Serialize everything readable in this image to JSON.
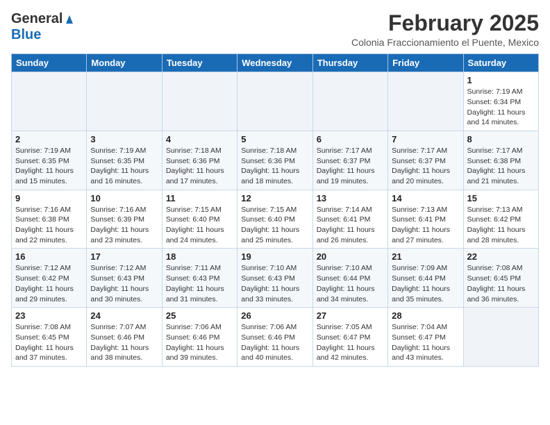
{
  "header": {
    "logo_general": "General",
    "logo_blue": "Blue",
    "month_title": "February 2025",
    "subtitle": "Colonia Fraccionamiento el Puente, Mexico"
  },
  "days_of_week": [
    "Sunday",
    "Monday",
    "Tuesday",
    "Wednesday",
    "Thursday",
    "Friday",
    "Saturday"
  ],
  "weeks": [
    [
      {
        "day": "",
        "info": ""
      },
      {
        "day": "",
        "info": ""
      },
      {
        "day": "",
        "info": ""
      },
      {
        "day": "",
        "info": ""
      },
      {
        "day": "",
        "info": ""
      },
      {
        "day": "",
        "info": ""
      },
      {
        "day": "1",
        "info": "Sunrise: 7:19 AM\nSunset: 6:34 PM\nDaylight: 11 hours and 14 minutes."
      }
    ],
    [
      {
        "day": "2",
        "info": "Sunrise: 7:19 AM\nSunset: 6:35 PM\nDaylight: 11 hours and 15 minutes."
      },
      {
        "day": "3",
        "info": "Sunrise: 7:19 AM\nSunset: 6:35 PM\nDaylight: 11 hours and 16 minutes."
      },
      {
        "day": "4",
        "info": "Sunrise: 7:18 AM\nSunset: 6:36 PM\nDaylight: 11 hours and 17 minutes."
      },
      {
        "day": "5",
        "info": "Sunrise: 7:18 AM\nSunset: 6:36 PM\nDaylight: 11 hours and 18 minutes."
      },
      {
        "day": "6",
        "info": "Sunrise: 7:17 AM\nSunset: 6:37 PM\nDaylight: 11 hours and 19 minutes."
      },
      {
        "day": "7",
        "info": "Sunrise: 7:17 AM\nSunset: 6:37 PM\nDaylight: 11 hours and 20 minutes."
      },
      {
        "day": "8",
        "info": "Sunrise: 7:17 AM\nSunset: 6:38 PM\nDaylight: 11 hours and 21 minutes."
      }
    ],
    [
      {
        "day": "9",
        "info": "Sunrise: 7:16 AM\nSunset: 6:38 PM\nDaylight: 11 hours and 22 minutes."
      },
      {
        "day": "10",
        "info": "Sunrise: 7:16 AM\nSunset: 6:39 PM\nDaylight: 11 hours and 23 minutes."
      },
      {
        "day": "11",
        "info": "Sunrise: 7:15 AM\nSunset: 6:40 PM\nDaylight: 11 hours and 24 minutes."
      },
      {
        "day": "12",
        "info": "Sunrise: 7:15 AM\nSunset: 6:40 PM\nDaylight: 11 hours and 25 minutes."
      },
      {
        "day": "13",
        "info": "Sunrise: 7:14 AM\nSunset: 6:41 PM\nDaylight: 11 hours and 26 minutes."
      },
      {
        "day": "14",
        "info": "Sunrise: 7:13 AM\nSunset: 6:41 PM\nDaylight: 11 hours and 27 minutes."
      },
      {
        "day": "15",
        "info": "Sunrise: 7:13 AM\nSunset: 6:42 PM\nDaylight: 11 hours and 28 minutes."
      }
    ],
    [
      {
        "day": "16",
        "info": "Sunrise: 7:12 AM\nSunset: 6:42 PM\nDaylight: 11 hours and 29 minutes."
      },
      {
        "day": "17",
        "info": "Sunrise: 7:12 AM\nSunset: 6:43 PM\nDaylight: 11 hours and 30 minutes."
      },
      {
        "day": "18",
        "info": "Sunrise: 7:11 AM\nSunset: 6:43 PM\nDaylight: 11 hours and 31 minutes."
      },
      {
        "day": "19",
        "info": "Sunrise: 7:10 AM\nSunset: 6:43 PM\nDaylight: 11 hours and 33 minutes."
      },
      {
        "day": "20",
        "info": "Sunrise: 7:10 AM\nSunset: 6:44 PM\nDaylight: 11 hours and 34 minutes."
      },
      {
        "day": "21",
        "info": "Sunrise: 7:09 AM\nSunset: 6:44 PM\nDaylight: 11 hours and 35 minutes."
      },
      {
        "day": "22",
        "info": "Sunrise: 7:08 AM\nSunset: 6:45 PM\nDaylight: 11 hours and 36 minutes."
      }
    ],
    [
      {
        "day": "23",
        "info": "Sunrise: 7:08 AM\nSunset: 6:45 PM\nDaylight: 11 hours and 37 minutes."
      },
      {
        "day": "24",
        "info": "Sunrise: 7:07 AM\nSunset: 6:46 PM\nDaylight: 11 hours and 38 minutes."
      },
      {
        "day": "25",
        "info": "Sunrise: 7:06 AM\nSunset: 6:46 PM\nDaylight: 11 hours and 39 minutes."
      },
      {
        "day": "26",
        "info": "Sunrise: 7:06 AM\nSunset: 6:46 PM\nDaylight: 11 hours and 40 minutes."
      },
      {
        "day": "27",
        "info": "Sunrise: 7:05 AM\nSunset: 6:47 PM\nDaylight: 11 hours and 42 minutes."
      },
      {
        "day": "28",
        "info": "Sunrise: 7:04 AM\nSunset: 6:47 PM\nDaylight: 11 hours and 43 minutes."
      },
      {
        "day": "",
        "info": ""
      }
    ]
  ]
}
